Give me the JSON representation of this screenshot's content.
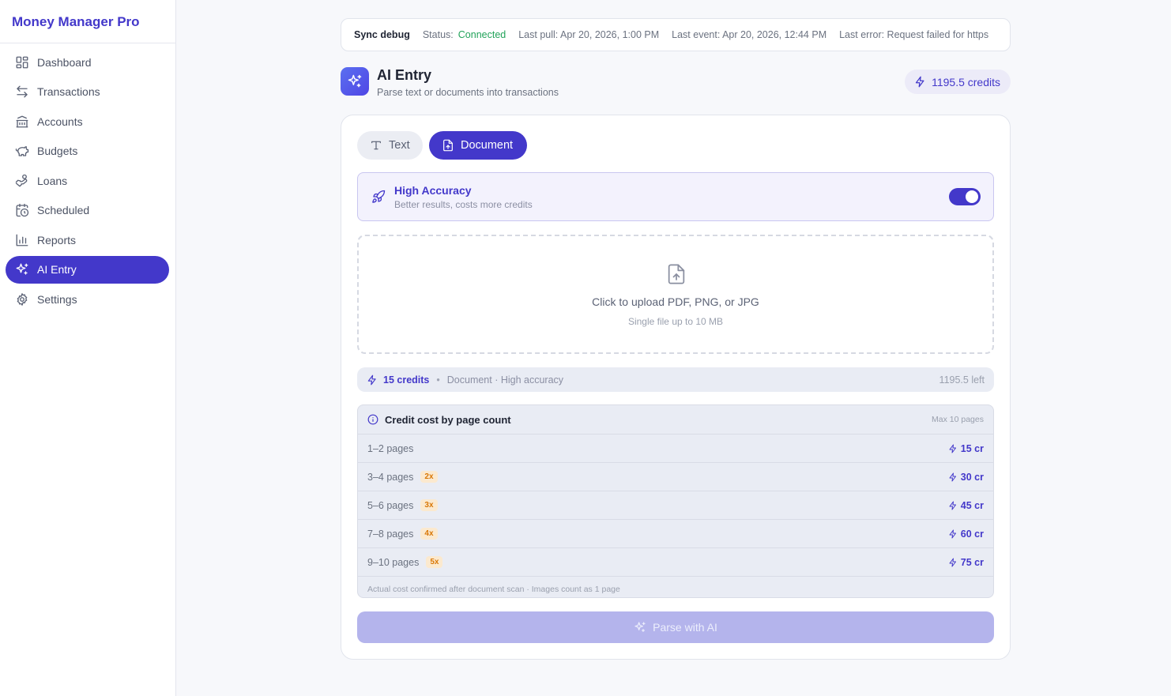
{
  "app": {
    "title": "Money Manager Pro"
  },
  "sidebar": {
    "items": [
      {
        "label": "Dashboard",
        "icon": "dashboard-icon",
        "active": false
      },
      {
        "label": "Transactions",
        "icon": "transactions-icon",
        "active": false
      },
      {
        "label": "Accounts",
        "icon": "bank-icon",
        "active": false
      },
      {
        "label": "Budgets",
        "icon": "piggy-bank-icon",
        "active": false
      },
      {
        "label": "Loans",
        "icon": "loan-icon",
        "active": false
      },
      {
        "label": "Scheduled",
        "icon": "calendar-clock-icon",
        "active": false
      },
      {
        "label": "Reports",
        "icon": "bar-chart-icon",
        "active": false
      },
      {
        "label": "AI Entry",
        "icon": "sparkles-icon",
        "active": true
      },
      {
        "label": "Settings",
        "icon": "gear-icon",
        "active": false
      }
    ]
  },
  "sync": {
    "title": "Sync debug",
    "status_label": "Status:",
    "status_value": "Connected",
    "last_pull": "Last pull: Apr 20, 2026, 1:00 PM",
    "last_event": "Last event: Apr 20, 2026, 12:44 PM",
    "last_error": "Last error: Request failed for https"
  },
  "header": {
    "title": "AI Entry",
    "subtitle": "Parse text or documents into transactions",
    "credits": "1195.5 credits"
  },
  "tabs": [
    {
      "label": "Text",
      "active": false
    },
    {
      "label": "Document",
      "active": true
    }
  ],
  "accuracy": {
    "title": "High Accuracy",
    "subtitle": "Better results, costs more credits",
    "enabled": true
  },
  "upload": {
    "main": "Click to upload PDF, PNG, or JPG",
    "sub": "Single file up to 10 MB"
  },
  "cost_summary": {
    "amount": "15 credits",
    "separator": "•",
    "desc": "Document · High accuracy",
    "left": "1195.5 left"
  },
  "cost_table": {
    "title": "Credit cost by page count",
    "max": "Max 10 pages",
    "rows": [
      {
        "pages": "1–2 pages",
        "multiplier": "",
        "cost": "15 cr"
      },
      {
        "pages": "3–4 pages",
        "multiplier": "2x",
        "cost": "30 cr"
      },
      {
        "pages": "5–6 pages",
        "multiplier": "3x",
        "cost": "45 cr"
      },
      {
        "pages": "7–8 pages",
        "multiplier": "4x",
        "cost": "60 cr"
      },
      {
        "pages": "9–10 pages",
        "multiplier": "5x",
        "cost": "75 cr"
      }
    ],
    "footnote": "Actual cost confirmed after document scan · Images count as 1 page"
  },
  "actions": {
    "parse_label": "Parse with AI"
  },
  "colors": {
    "accent": "#4338ca",
    "connected": "#22a35a",
    "badge": "#d97706"
  }
}
